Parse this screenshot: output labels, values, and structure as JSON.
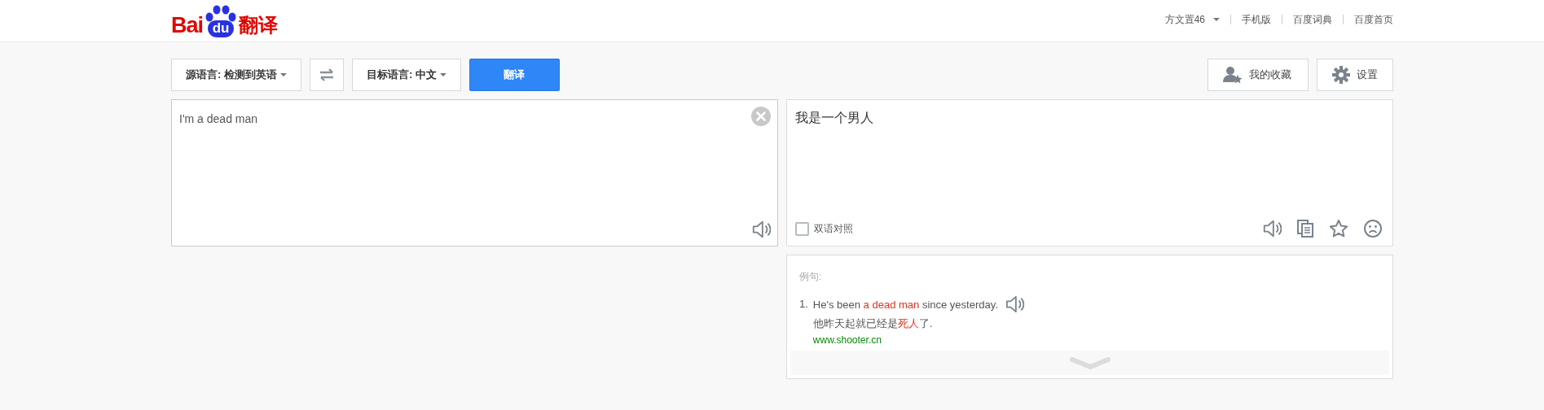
{
  "header": {
    "logo": {
      "left": "Bai",
      "badge": "du",
      "product": "翻译"
    },
    "user": {
      "label": "方文置46"
    },
    "links": [
      "手机版",
      "百度词典",
      "百度首页"
    ]
  },
  "toolbar": {
    "source": {
      "label": "源语言: 检测到英语"
    },
    "target": {
      "label": "目标语言: 中文"
    },
    "translate": "翻译",
    "right_buttons": [
      {
        "kind": "favorites",
        "label": "我的收藏"
      },
      {
        "kind": "settings",
        "label": "设置"
      }
    ]
  },
  "input": {
    "value": "I'm a dead man"
  },
  "output": {
    "text": "我是一个男人",
    "bilingual": {
      "label": "双语对照",
      "checked": false
    },
    "actions": [
      {
        "kind": "speaker"
      },
      {
        "kind": "copy"
      },
      {
        "kind": "star"
      },
      {
        "kind": "feedback"
      }
    ]
  },
  "examples": {
    "title": "例句:",
    "items": [
      {
        "number": "1.",
        "en": [
          {
            "text": "He's been ",
            "highlight": false
          },
          {
            "text": "a dead man",
            "highlight": true
          },
          {
            "text": " since yesterday.",
            "highlight": false
          }
        ],
        "zh": [
          {
            "text": "他昨天起就已经是",
            "highlight": false
          },
          {
            "text": "死人",
            "highlight": true
          },
          {
            "text": "了.",
            "highlight": false
          }
        ],
        "source": "www.shooter.cn"
      }
    ]
  }
}
